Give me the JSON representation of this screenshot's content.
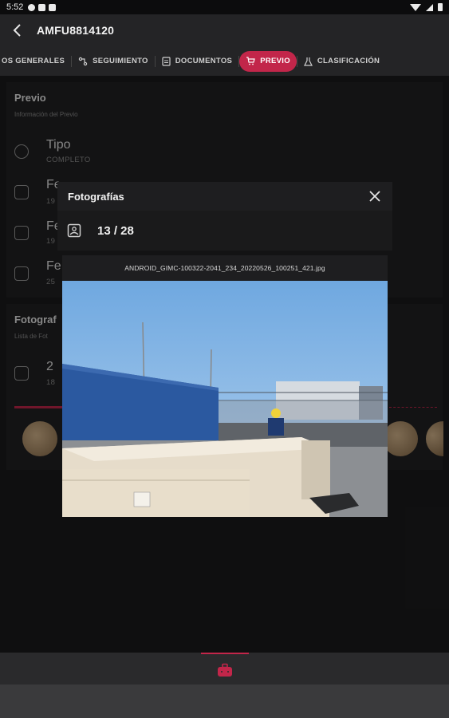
{
  "status_bar": {
    "time": "5:52"
  },
  "app_bar": {
    "title": "AMFU8814120"
  },
  "tabs": [
    {
      "label": "DATOS GENERALES",
      "visible_label": "OS GENERALES",
      "icon": "info-icon",
      "active": false
    },
    {
      "label": "SEGUIMIENTO",
      "icon": "route-icon",
      "active": false
    },
    {
      "label": "DOCUMENTOS",
      "icon": "document-icon",
      "active": false
    },
    {
      "label": "PREVIO",
      "icon": "cart-icon",
      "active": true
    },
    {
      "label": "CLASIFICACIÓN",
      "icon": "flask-icon",
      "active": false
    }
  ],
  "previo_card": {
    "title": "Previo",
    "subtitle": "Información del Previo",
    "rows": [
      {
        "label": "Tipo",
        "value": "COMPLETO",
        "icon": "clock-icon"
      },
      {
        "label": "Fe",
        "value": "19",
        "icon": "calendar-icon"
      },
      {
        "label": "Fe",
        "value": "19",
        "icon": "calendar-icon"
      },
      {
        "label": "Fe",
        "value": "25",
        "icon": "calendar-icon"
      }
    ]
  },
  "photos_card": {
    "title": "Fotograf",
    "subtitle": "Lista de Fot",
    "count_label": "2",
    "count_sub": "18"
  },
  "dialog": {
    "title": "Fotografías",
    "counter": "13 / 28",
    "file_name": "ANDROID_GIMC-100322-2041_234_20220526_100251_421.jpg"
  },
  "colors": {
    "accent": "#c2264a",
    "background": "#1b1b1d",
    "surface": "#242426"
  }
}
